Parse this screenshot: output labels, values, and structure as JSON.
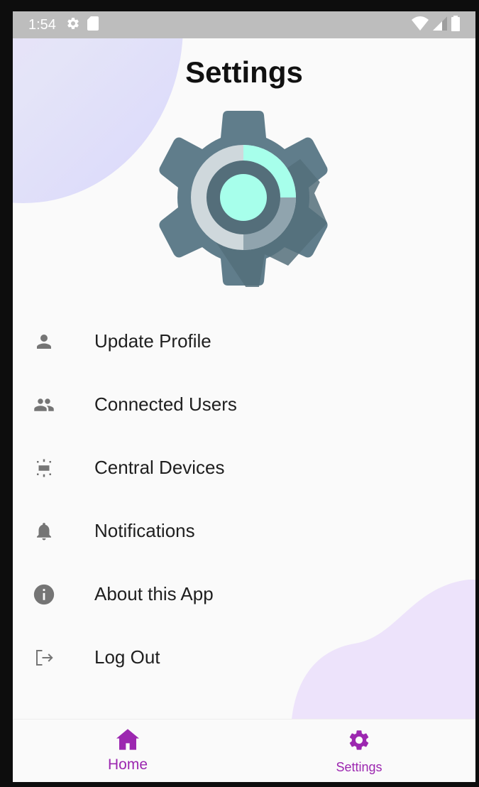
{
  "status_bar": {
    "time": "1:54",
    "icons": [
      "gear-icon",
      "sd-card-icon",
      "wifi-icon",
      "signal-icon",
      "battery-icon"
    ]
  },
  "page": {
    "title": "Settings",
    "hero_icon": "gear-icon"
  },
  "menu": {
    "items": [
      {
        "label": "Update Profile",
        "icon": "person-icon"
      },
      {
        "label": "Connected Users",
        "icon": "people-icon"
      },
      {
        "label": "Central Devices",
        "icon": "device-hub-icon"
      },
      {
        "label": "Notifications",
        "icon": "bell-icon"
      },
      {
        "label": "About this App",
        "icon": "info-icon"
      },
      {
        "label": "Log Out",
        "icon": "logout-icon"
      }
    ]
  },
  "bottom_nav": {
    "items": [
      {
        "label": "Home",
        "icon": "home-icon"
      },
      {
        "label": "Settings",
        "icon": "gear-icon"
      }
    ]
  },
  "colors": {
    "accent": "#9c27b0",
    "gear_body": "#607d8b",
    "gear_highlight": "#a7ffeb",
    "icon_gray": "#757575"
  }
}
